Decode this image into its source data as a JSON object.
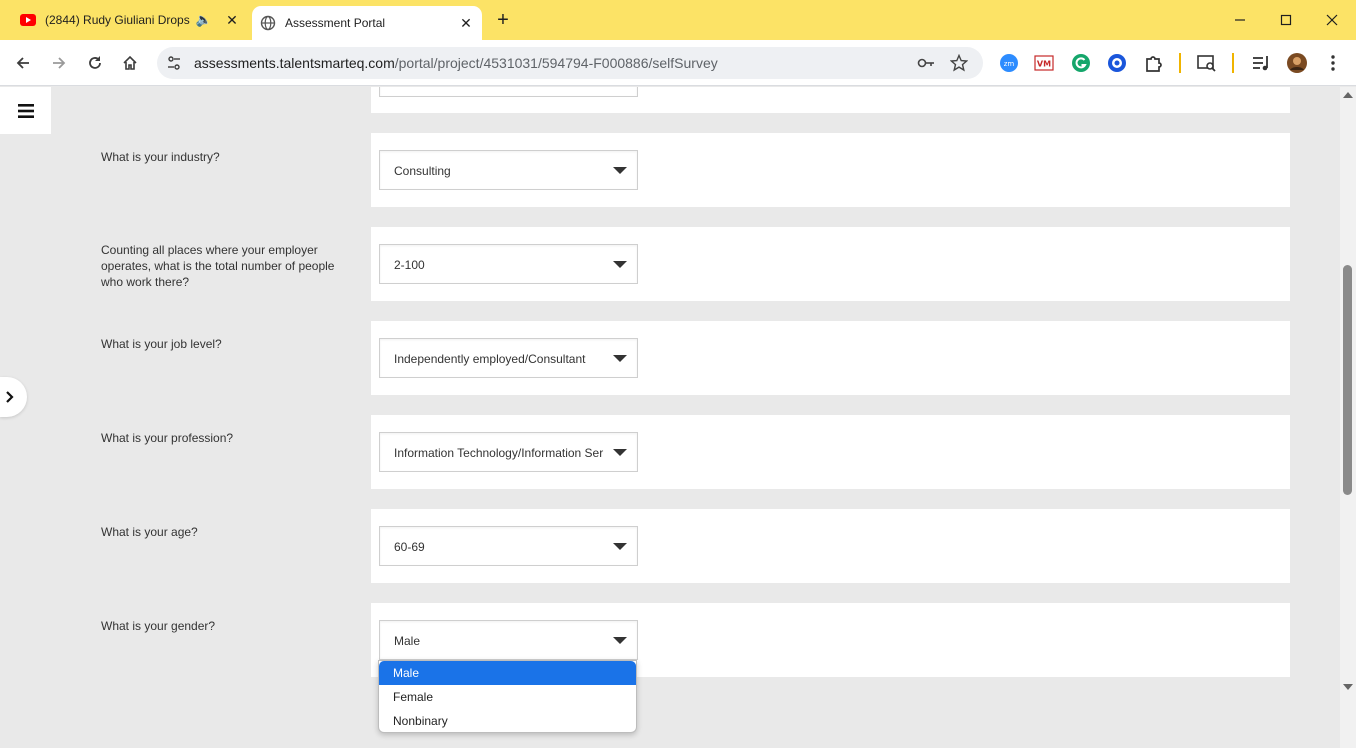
{
  "browser": {
    "tabs": [
      {
        "title": "(2844) Rudy Giuliani Drops",
        "favicon": "youtube-icon",
        "audio": true
      },
      {
        "title": "Assessment Portal",
        "favicon": "globe-icon",
        "active": true
      }
    ],
    "address": {
      "host": "assessments.talentsmarteq.com",
      "path": "/portal/project/4531031/594794-F000886/selfSurvey"
    },
    "extensions": [
      "zoom-icon",
      "vm-icon",
      "grammarly-icon",
      "target-icon",
      "puzzle-icon",
      "tab-search-icon",
      "media-icon",
      "profile-avatar"
    ]
  },
  "survey": {
    "questions": [
      {
        "label": "What is your industry?",
        "value": "Consulting"
      },
      {
        "label": "Counting all places where your employer operates, what is the total number of people who work there?",
        "value": "2-100"
      },
      {
        "label": "What is your job level?",
        "value": "Independently employed/Consultant"
      },
      {
        "label": "What is your profession?",
        "value": "Information Technology/Information Ser"
      },
      {
        "label": "What is your age?",
        "value": "60-69"
      },
      {
        "label": "What is your gender?",
        "value": "Male"
      }
    ],
    "gender_options": [
      "Male",
      "Female",
      "Nonbinary"
    ]
  },
  "colors": {
    "tabstrip": "#fce366",
    "selected_option": "#1a73e8",
    "page_bg": "#e9e9e9"
  }
}
